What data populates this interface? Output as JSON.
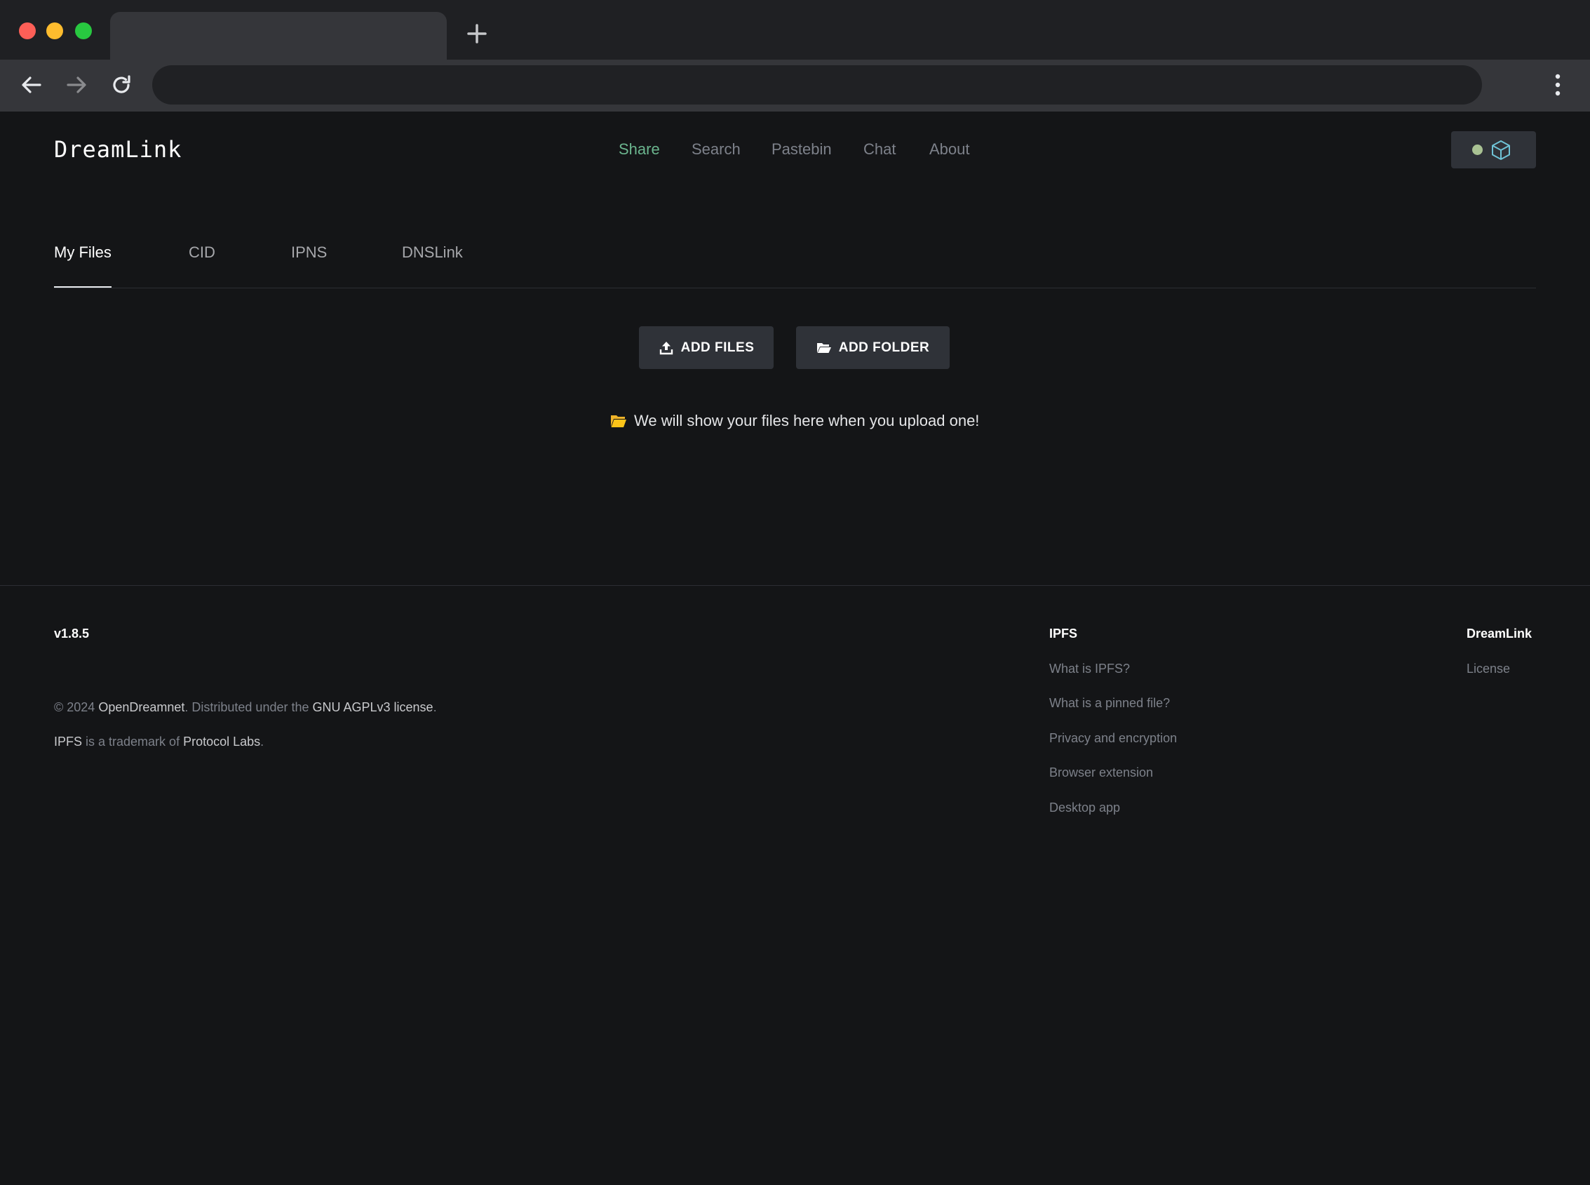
{
  "app": {
    "brand": "DreamLink",
    "nav": [
      {
        "label": "Share",
        "active": true
      },
      {
        "label": "Search"
      },
      {
        "label": "Pastebin"
      },
      {
        "label": "Chat"
      },
      {
        "label": "About"
      }
    ],
    "status_color": "#a9c293"
  },
  "tabs": [
    "My Files",
    "CID",
    "IPNS",
    "DNSLink"
  ],
  "actions": {
    "add_files": "ADD FILES",
    "add_folder": "ADD FOLDER"
  },
  "empty_message": "We will show your files here when you upload one!",
  "footer": {
    "version": "v1.8.5",
    "copyright_prefix": "© 2024 ",
    "org": "OpenDreamnet",
    "distributed": ". Distributed under the ",
    "license_link": "GNU AGPLv3 license",
    "period": ".",
    "ipfs_word": "IPFS",
    "trademark_text": " is a trademark of ",
    "protocol_labs": "Protocol Labs",
    "ipfs_col": {
      "title": "IPFS",
      "links": [
        "What is IPFS?",
        "What is a pinned file?",
        "Privacy and encryption",
        "Browser extension",
        "Desktop app"
      ]
    },
    "dreamlink_col": {
      "title": "DreamLink",
      "links": [
        "License"
      ]
    }
  },
  "colors": {
    "background": "#141517",
    "accent": "#6bb58e",
    "button": "#2f3238",
    "folder": "#fcc419"
  }
}
